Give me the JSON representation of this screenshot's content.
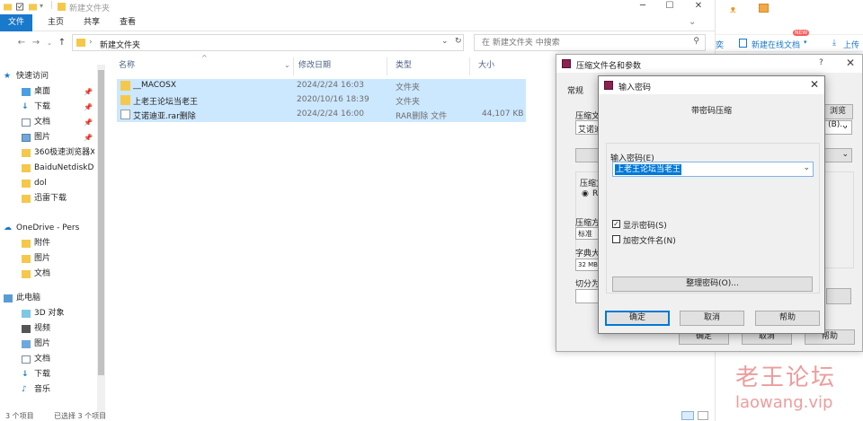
{
  "window": {
    "title": "新建文件夹"
  },
  "ribbon": {
    "tabs": [
      "文件",
      "主页",
      "共享",
      "查看"
    ]
  },
  "address": {
    "path": "新建文件夹",
    "search_placeholder": "在 新建文件夹 中搜索"
  },
  "nav": {
    "quick_access": "快速访问",
    "items": [
      {
        "label": "桌面",
        "pinned": true
      },
      {
        "label": "下载",
        "pinned": true
      },
      {
        "label": "文档",
        "pinned": true
      },
      {
        "label": "图片",
        "pinned": true
      },
      {
        "label": "360极速浏览器X",
        "pinned": false
      },
      {
        "label": "BaiduNetdiskD",
        "pinned": false
      },
      {
        "label": "dol",
        "pinned": false
      },
      {
        "label": "迅雷下载",
        "pinned": false
      }
    ],
    "onedrive": "OneDrive - Pers",
    "onedrive_items": [
      "附件",
      "图片",
      "文档"
    ],
    "this_pc": "此电脑",
    "pc_items": [
      "3D 对象",
      "视频",
      "图片",
      "文档",
      "下载",
      "音乐"
    ]
  },
  "columns": {
    "name": "名称",
    "date": "修改日期",
    "type": "类型",
    "size": "大小"
  },
  "files": [
    {
      "name": "__MACOSX",
      "date": "2024/2/24 16:03",
      "type": "文件夹",
      "size": "",
      "icon": "folder-icon"
    },
    {
      "name": "上老王论坛当老王",
      "date": "2020/10/16 18:39",
      "type": "文件夹",
      "size": "",
      "icon": "folder-icon"
    },
    {
      "name": "艾诺迪亚.rar删除",
      "date": "2024/2/24 16:00",
      "type": "RAR删除 文件",
      "size": "44,107 KB",
      "icon": "file-icon"
    }
  ],
  "status": {
    "count": "3 个项目",
    "selected": "已选择 3 个项目"
  },
  "rightapp": {
    "new_online_doc": "新建在线文档",
    "badge": "NEW",
    "tab2": "上传"
  },
  "rar_dialog": {
    "title": "压缩文件名和参数",
    "tab_general": "常规",
    "archive_label": "压缩文",
    "archive_value": "艾诺迪",
    "browse": "浏览(B)...",
    "format_label": "压缩文",
    "format_value": "RA",
    "method_label": "压缩方",
    "method_value": "标准",
    "dict_label": "字典大",
    "dict_value": "32 MB",
    "split_label": "切分为",
    "help_q": "?",
    "ok": "确定",
    "cancel": "取消",
    "help": "帮助"
  },
  "pw_dialog": {
    "title": "输入密码",
    "heading": "带密码压缩",
    "label": "输入密码(E)",
    "value": "上老王论坛当老王",
    "show_password": "显示密码(S)",
    "show_password_checked": true,
    "encrypt_names": "加密文件名(N)",
    "encrypt_names_checked": false,
    "organize": "整理密码(O)...",
    "ok": "确定",
    "cancel": "取消",
    "help": "帮助"
  },
  "watermark": {
    "cn": "老王论坛",
    "url": "laowang.vip"
  },
  "colors": {
    "accent": "#1979ca",
    "selection": "#cce8ff",
    "folder": "#f5c84c",
    "watermark": "#e87b7b"
  }
}
